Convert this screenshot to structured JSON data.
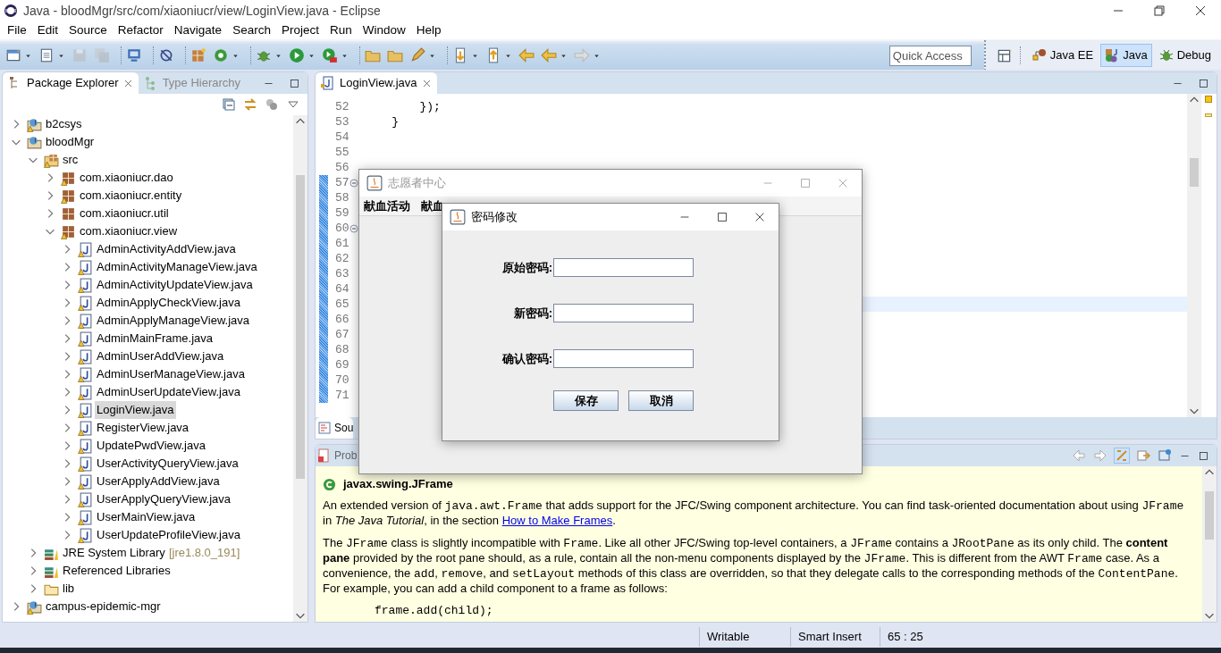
{
  "window": {
    "title": "Java - bloodMgr/src/com/xiaoniucr/view/LoginView.java - Eclipse"
  },
  "menu": [
    "File",
    "Edit",
    "Source",
    "Refactor",
    "Navigate",
    "Search",
    "Project",
    "Run",
    "Window",
    "Help"
  ],
  "toolbar": {
    "quick_access": {
      "placeholder": "Quick Access"
    },
    "perspectives": [
      {
        "label": "Java EE",
        "selected": false
      },
      {
        "label": "Java",
        "selected": true
      },
      {
        "label": "Debug",
        "selected": false
      }
    ]
  },
  "package_explorer": {
    "tabs": [
      {
        "label": "Package Explorer",
        "selected": true
      },
      {
        "label": "Type Hierarchy",
        "selected": false
      }
    ],
    "tree": [
      {
        "label": "b2csys",
        "kind": "project",
        "warning": true,
        "expanded": false,
        "selected": false
      },
      {
        "label": "bloodMgr",
        "kind": "project",
        "warning": false,
        "expanded": true,
        "selected": false,
        "children": [
          {
            "label": "src",
            "kind": "source-folder",
            "warning": true,
            "expanded": true,
            "selected": false,
            "children": [
              {
                "label": "com.xiaoniucr.dao",
                "kind": "package",
                "warning": true,
                "expanded": false,
                "selected": false
              },
              {
                "label": "com.xiaoniucr.entity",
                "kind": "package",
                "warning": true,
                "expanded": false,
                "selected": false
              },
              {
                "label": "com.xiaoniucr.util",
                "kind": "package",
                "warning": false,
                "expanded": false,
                "selected": false
              },
              {
                "label": "com.xiaoniucr.view",
                "kind": "package",
                "warning": true,
                "expanded": true,
                "selected": false,
                "children": [
                  {
                    "label": "AdminActivityAddView.java",
                    "kind": "java-file",
                    "warning": true,
                    "expanded": false,
                    "selected": false
                  },
                  {
                    "label": "AdminActivityManageView.java",
                    "kind": "java-file",
                    "warning": true,
                    "expanded": false,
                    "selected": false
                  },
                  {
                    "label": "AdminActivityUpdateView.java",
                    "kind": "java-file",
                    "warning": true,
                    "expanded": false,
                    "selected": false
                  },
                  {
                    "label": "AdminApplyCheckView.java",
                    "kind": "java-file",
                    "warning": true,
                    "expanded": false,
                    "selected": false
                  },
                  {
                    "label": "AdminApplyManageView.java",
                    "kind": "java-file",
                    "warning": true,
                    "expanded": false,
                    "selected": false
                  },
                  {
                    "label": "AdminMainFrame.java",
                    "kind": "java-file",
                    "warning": true,
                    "expanded": false,
                    "selected": false
                  },
                  {
                    "label": "AdminUserAddView.java",
                    "kind": "java-file",
                    "warning": true,
                    "expanded": false,
                    "selected": false
                  },
                  {
                    "label": "AdminUserManageView.java",
                    "kind": "java-file",
                    "warning": true,
                    "expanded": false,
                    "selected": false
                  },
                  {
                    "label": "AdminUserUpdateView.java",
                    "kind": "java-file",
                    "warning": true,
                    "expanded": false,
                    "selected": false
                  },
                  {
                    "label": "LoginView.java",
                    "kind": "java-file",
                    "warning": true,
                    "expanded": false,
                    "selected": true
                  },
                  {
                    "label": "RegisterView.java",
                    "kind": "java-file",
                    "warning": true,
                    "expanded": false,
                    "selected": false
                  },
                  {
                    "label": "UpdatePwdView.java",
                    "kind": "java-file",
                    "warning": true,
                    "expanded": false,
                    "selected": false
                  },
                  {
                    "label": "UserActivityQueryView.java",
                    "kind": "java-file",
                    "warning": true,
                    "expanded": false,
                    "selected": false
                  },
                  {
                    "label": "UserApplyAddView.java",
                    "kind": "java-file",
                    "warning": true,
                    "expanded": false,
                    "selected": false
                  },
                  {
                    "label": "UserApplyQueryView.java",
                    "kind": "java-file",
                    "warning": true,
                    "expanded": false,
                    "selected": false
                  },
                  {
                    "label": "UserMainView.java",
                    "kind": "java-file",
                    "warning": true,
                    "expanded": false,
                    "selected": false
                  },
                  {
                    "label": "UserUpdateProfileView.java",
                    "kind": "java-file",
                    "warning": true,
                    "expanded": false,
                    "selected": false
                  }
                ]
              }
            ]
          },
          {
            "label": "JRE System Library",
            "decoration": "[jre1.8.0_191]",
            "kind": "library",
            "warning": false,
            "expanded": false,
            "selected": false
          },
          {
            "label": "Referenced Libraries",
            "kind": "library",
            "warning": false,
            "expanded": false,
            "selected": false
          },
          {
            "label": "lib",
            "kind": "folder",
            "warning": false,
            "expanded": false,
            "selected": false
          }
        ]
      },
      {
        "label": "campus-epidemic-mgr",
        "kind": "project",
        "warning": true,
        "expanded": false,
        "selected": false
      }
    ]
  },
  "editor": {
    "tabs": [
      {
        "label": "LoginView.java",
        "selected": true
      }
    ],
    "lines": [
      {
        "number": "52",
        "code": "        });",
        "changed": false,
        "fold": false,
        "current": false
      },
      {
        "number": "53",
        "code": "    }",
        "changed": false,
        "fold": false,
        "current": false
      },
      {
        "number": "54",
        "changed": false,
        "fold": false,
        "current": false
      },
      {
        "number": "55",
        "changed": false,
        "fold": false,
        "current": false
      },
      {
        "number": "56",
        "changed": false,
        "fold": false,
        "current": false
      },
      {
        "number": "57",
        "changed": true,
        "fold": true,
        "current": false
      },
      {
        "number": "58",
        "changed": true,
        "fold": false,
        "current": false
      },
      {
        "number": "59",
        "changed": true,
        "fold": false,
        "current": false
      },
      {
        "number": "60",
        "changed": true,
        "fold": true,
        "current": false
      },
      {
        "number": "61",
        "changed": true,
        "fold": false,
        "current": false
      },
      {
        "number": "62",
        "changed": true,
        "fold": false,
        "current": false
      },
      {
        "number": "63",
        "changed": true,
        "fold": false,
        "current": false
      },
      {
        "number": "64",
        "changed": true,
        "fold": false,
        "current": false
      },
      {
        "number": "65",
        "changed": true,
        "fold": false,
        "current": true
      },
      {
        "number": "66",
        "changed": true,
        "fold": false,
        "current": false
      },
      {
        "number": "67",
        "changed": true,
        "fold": false,
        "current": false
      },
      {
        "number": "68",
        "changed": true,
        "fold": false,
        "current": false
      },
      {
        "number": "69",
        "changed": true,
        "fold": false,
        "current": false
      },
      {
        "number": "70",
        "changed": true,
        "fold": false,
        "current": false
      },
      {
        "number": "71",
        "changed": true,
        "fold": false,
        "current": false
      }
    ],
    "bottom_tab": "Sou"
  },
  "javadoc": {
    "tab": "Prob",
    "title": "javax.swing.JFrame",
    "paragraphs": [
      [
        {
          "kind": "text",
          "text": "An extended version of "
        },
        {
          "kind": "code",
          "text": "java.awt.Frame"
        },
        {
          "kind": "text",
          "text": " that adds support for the JFC/Swing component architecture. You can find task-oriented documentation about using "
        },
        {
          "kind": "code",
          "text": "JFrame"
        },
        {
          "kind": "text",
          "text": " in "
        },
        {
          "kind": "italic",
          "text": "The Java Tutorial"
        },
        {
          "kind": "text",
          "text": ", in the section "
        },
        {
          "kind": "link",
          "text": "How to Make Frames"
        },
        {
          "kind": "text",
          "text": "."
        }
      ],
      [
        {
          "kind": "text",
          "text": "The "
        },
        {
          "kind": "code",
          "text": "JFrame"
        },
        {
          "kind": "text",
          "text": " class is slightly incompatible with "
        },
        {
          "kind": "code",
          "text": "Frame"
        },
        {
          "kind": "text",
          "text": ". Like all other JFC/Swing top-level containers, a "
        },
        {
          "kind": "code",
          "text": "JFrame"
        },
        {
          "kind": "text",
          "text": " contains a "
        },
        {
          "kind": "code",
          "text": "JRootPane"
        },
        {
          "kind": "text",
          "text": " as its only child. The "
        },
        {
          "kind": "bold",
          "text": "content pane"
        },
        {
          "kind": "text",
          "text": " provided by the root pane should, as a rule, contain all the non-menu components displayed by the "
        },
        {
          "kind": "code",
          "text": "JFrame"
        },
        {
          "kind": "text",
          "text": ". This is different from the AWT "
        },
        {
          "kind": "code",
          "text": "Frame"
        },
        {
          "kind": "text",
          "text": " case. As a convenience, the "
        },
        {
          "kind": "code",
          "text": "add"
        },
        {
          "kind": "text",
          "text": ", "
        },
        {
          "kind": "code",
          "text": "remove"
        },
        {
          "kind": "text",
          "text": ", and "
        },
        {
          "kind": "code",
          "text": "setLayout"
        },
        {
          "kind": "text",
          "text": " methods of this class are overridden, so that they delegate calls to the corresponding methods of the "
        },
        {
          "kind": "code",
          "text": "ContentPane"
        },
        {
          "kind": "text",
          "text": ". For example, you can add a child component to a frame as follows:"
        }
      ]
    ],
    "code": "frame.add(child);"
  },
  "status_bar": [
    "Writable",
    "Smart Insert",
    "65 : 25"
  ],
  "volunteer_window": {
    "title": "志愿者中心",
    "active": false,
    "menu": [
      "献血活动",
      "献血"
    ]
  },
  "password_dialog": {
    "title": "密码修改",
    "active": true,
    "fields": [
      {
        "label": "原始密码:"
      },
      {
        "label": "新密码:"
      },
      {
        "label": "确认密码:"
      }
    ],
    "buttons": [
      "保存",
      "取消"
    ]
  }
}
